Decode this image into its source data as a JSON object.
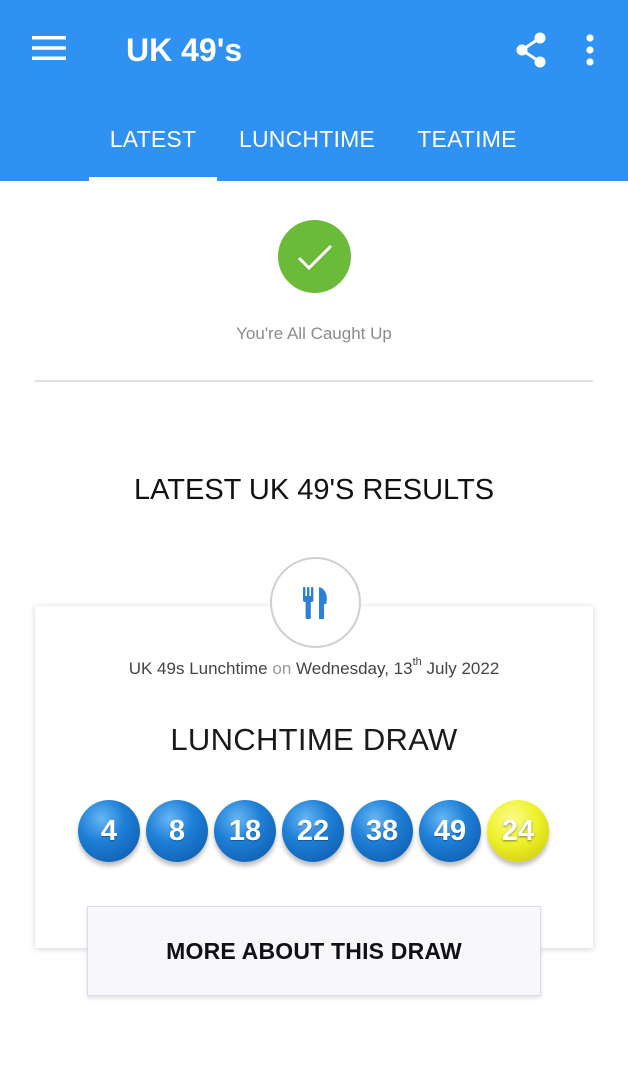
{
  "app": {
    "title": "UK 49's"
  },
  "header": {
    "menu_icon": "hamburger-menu-icon",
    "share_icon": "share-icon",
    "more_icon": "more-vert-icon",
    "background_color": "#2f92f2"
  },
  "tabs": [
    {
      "label": "LATEST",
      "active": true
    },
    {
      "label": "LUNCHTIME",
      "active": false
    },
    {
      "label": "TEATIME",
      "active": false
    }
  ],
  "status": {
    "icon": "check-icon",
    "icon_color": "#6cba3a",
    "text": "You're All Caught Up"
  },
  "results": {
    "heading": "LATEST UK 49'S RESULTS",
    "draw_icon": "cutlery-icon",
    "meta": {
      "draw_name": "UK 49s Lunchtime",
      "on": "on",
      "weekday_day": "Wednesday, 13",
      "ordinal_suffix": "th",
      "month_year": "July 2022"
    },
    "draw_title": "LUNCHTIME DRAW",
    "balls": [
      {
        "number": "4",
        "color": "blue"
      },
      {
        "number": "8",
        "color": "blue"
      },
      {
        "number": "18",
        "color": "blue"
      },
      {
        "number": "22",
        "color": "blue"
      },
      {
        "number": "38",
        "color": "blue"
      },
      {
        "number": "49",
        "color": "blue"
      },
      {
        "number": "24",
        "color": "yellow"
      }
    ],
    "more_button_label": "MORE ABOUT THIS DRAW"
  }
}
